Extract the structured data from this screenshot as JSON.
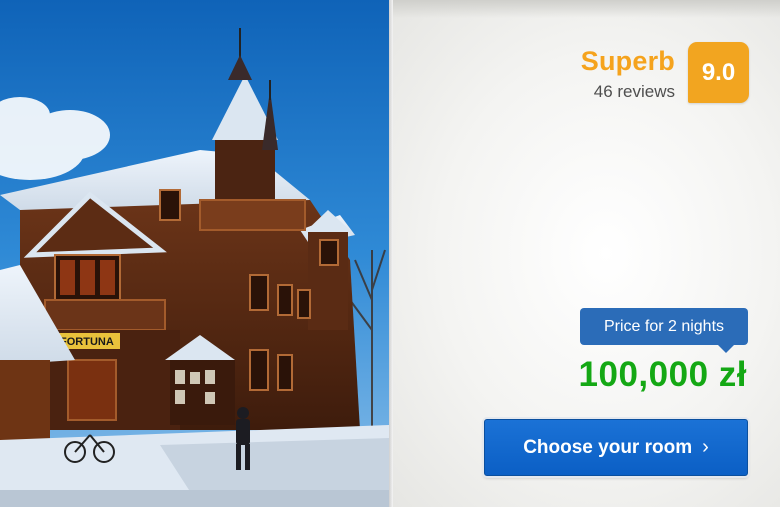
{
  "photo": {
    "shop_sign": "FORTUNA"
  },
  "review": {
    "rating_label": "Superb",
    "review_count": "46 reviews",
    "score": "9.0",
    "accent_color": "#f2a520"
  },
  "price": {
    "tooltip": "Price for 2 nights",
    "amount": "100,000 zł",
    "amount_color": "#14a814",
    "tooltip_color": "#2b6cb8"
  },
  "cta": {
    "label": "Choose your room",
    "icon": "chevron-right-icon",
    "color": "#0b5fc5"
  }
}
